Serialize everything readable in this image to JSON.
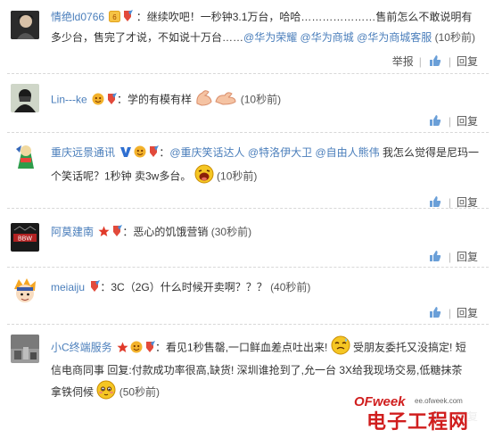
{
  "comments": [
    {
      "user": "情绝ld0766",
      "text_a": "：继续吹吧！一秒钟3.1万台，哈哈…………………售前怎么不敢说明有多少台，售完了才说，不如说十万台……",
      "mentions": [
        "@华为荣耀",
        "@华为商城",
        "@华为商城客服"
      ],
      "time": "(10秒前)",
      "report": "举报",
      "reply": "回复"
    },
    {
      "user": "Lin---ke",
      "text_a": "：学的有模有样",
      "time": "(10秒前)",
      "reply": "回复"
    },
    {
      "user": "重庆远景通讯",
      "text_a": "：",
      "mentions": [
        "@重庆笑话达人",
        "@特洛伊大卫",
        "@自由人熊伟"
      ],
      "text_b": " 我怎么觉得是尼玛一个笑话呢？1秒钟 卖3w多台。",
      "time": "(10秒前)",
      "reply": "回复"
    },
    {
      "user": "阿莫建南",
      "text_a": "：恶心的饥饿营销",
      "time": "(30秒前)",
      "reply": "回复"
    },
    {
      "user": "meiaiju",
      "text_a": "：3C（2G）什么时候开卖啊？？？",
      "time": "(40秒前)",
      "reply": "回复"
    },
    {
      "user": "小C终端服务",
      "text_a": "：看见1秒售罄,一口鲜血差点吐出来!",
      "text_b": "受朋友委托又没搞定! 短信电商同事 回复:付款成功率很高,缺货! 深圳谁抢到了,允一台 3X给我现场交易,低糖抹茶拿铁伺候",
      "time": "(50秒前)",
      "reply": "回复"
    }
  ],
  "watermark": {
    "logo": "OFweek",
    "url": "ee.ofweek.com",
    "name": "电子工程网"
  },
  "colors": {
    "link": "#4a7ebb",
    "brand_red": "#d01e1e"
  }
}
